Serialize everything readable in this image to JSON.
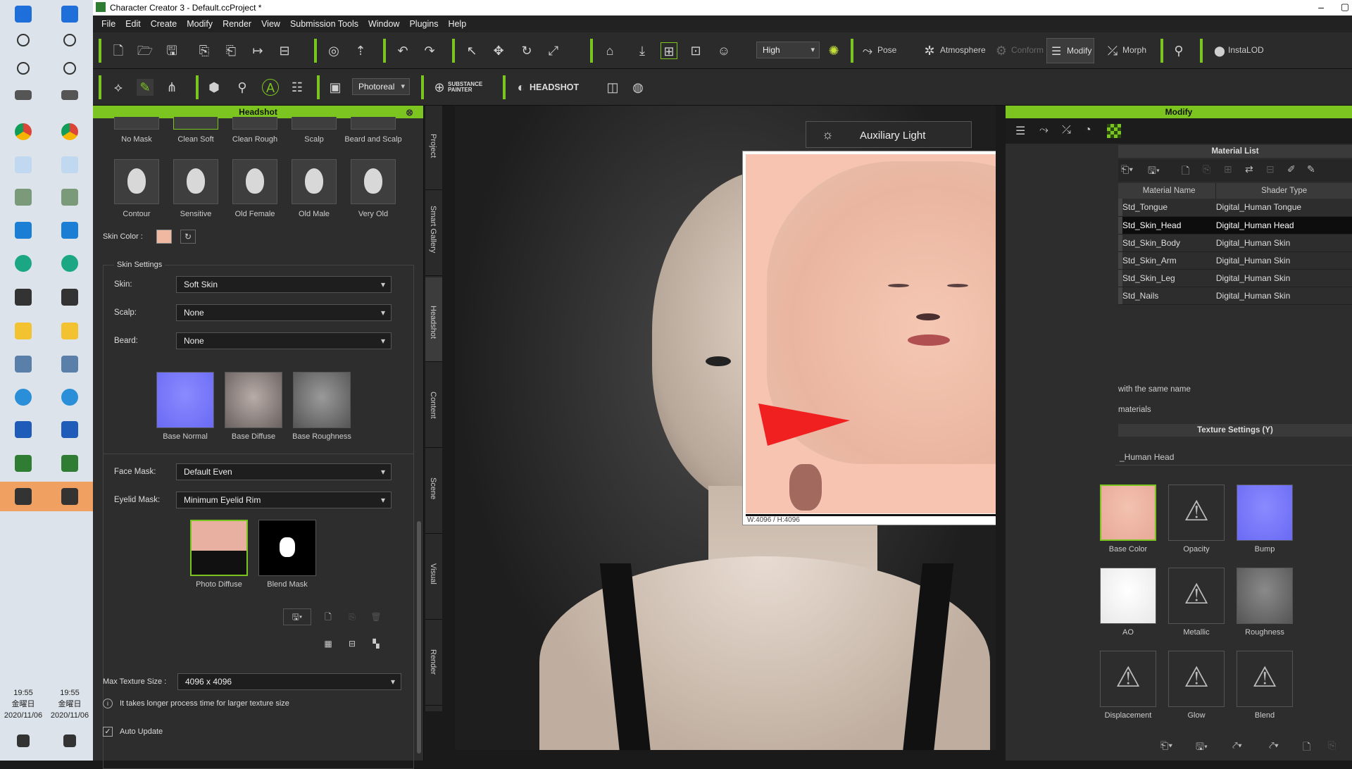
{
  "app": {
    "title": "Character Creator 3 - Default.ccProject *"
  },
  "menu": [
    "File",
    "Edit",
    "Create",
    "Modify",
    "Render",
    "View",
    "Submission Tools",
    "Window",
    "Plugins",
    "Help"
  ],
  "toolbar1": {
    "quality": "High",
    "pose_label": "Pose",
    "atmosphere_label": "Atmosphere",
    "conform_label": "Conform",
    "modify_label": "Modify",
    "morph_label": "Morph",
    "instalod_label": "InstaLOD"
  },
  "toolbar2": {
    "render_mode": "Photoreal",
    "substance_label": "SUBSTANCE PAINTER",
    "headshot_label": "HEADSHOT"
  },
  "headshot_panel": {
    "title": "Headshot",
    "top_presets": [
      {
        "label": "No Mask"
      },
      {
        "label": "Clean Soft"
      },
      {
        "label": "Clean Rough"
      },
      {
        "label": "Scalp"
      },
      {
        "label": "Beard and Scalp"
      }
    ],
    "presets": [
      {
        "label": "Contour"
      },
      {
        "label": "Sensitive"
      },
      {
        "label": "Old Female"
      },
      {
        "label": "Old Male"
      },
      {
        "label": "Very Old"
      }
    ],
    "skin_color_label": "Skin Color :",
    "skin_color": "#f0b8a0",
    "skin_settings_label": "Skin Settings",
    "skin_label": "Skin:",
    "skin_value": "Soft Skin",
    "scalp_label": "Scalp:",
    "scalp_value": "None",
    "beard_label": "Beard:",
    "beard_value": "None",
    "maps": [
      {
        "label": "Base Normal"
      },
      {
        "label": "Base Diffuse"
      },
      {
        "label": "Base Roughness"
      }
    ],
    "face_mask_label": "Face Mask:",
    "face_mask_value": "Default Even",
    "eyelid_mask_label": "Eyelid Mask:",
    "eyelid_mask_value": "Minimum Eyelid Rim",
    "photo_maps": [
      {
        "label": "Photo Diffuse"
      },
      {
        "label": "Blend Mask"
      }
    ],
    "max_texture_label": "Max Texture Size :",
    "max_texture_value": "4096 x 4096",
    "info_text": "It takes longer process time for larger texture size",
    "auto_update_label": "Auto Update"
  },
  "vertical_tabs": [
    "Project",
    "Smart Gallery",
    "Headshot",
    "Content",
    "Scene",
    "Visual",
    "Render"
  ],
  "viewport": {
    "aux_light_label": "Auxiliary Light",
    "texture_size": "W:4096 / H:4096"
  },
  "modify_panel": {
    "title": "Modify",
    "material_list_label": "Material List",
    "columns": [
      "Material Name",
      "Shader Type"
    ],
    "materials": [
      {
        "name": "Std_Tongue",
        "shader": "Digital_Human Tongue"
      },
      {
        "name": "Std_Skin_Head",
        "shader": "Digital_Human Head"
      },
      {
        "name": "Std_Skin_Body",
        "shader": "Digital_Human Skin"
      },
      {
        "name": "Std_Skin_Arm",
        "shader": "Digital_Human Skin"
      },
      {
        "name": "Std_Skin_Leg",
        "shader": "Digital_Human Skin"
      },
      {
        "name": "Std_Nails",
        "shader": "Digital_Human Skin"
      }
    ],
    "selected_index": 1,
    "same_name_text": "with the same name",
    "materials_text": "materials",
    "texture_settings_label": "Texture Settings  (Y)",
    "shader_name": "_Human Head",
    "textures": [
      {
        "label": "Base Color"
      },
      {
        "label": "Opacity"
      },
      {
        "label": "Bump"
      },
      {
        "label": "AO"
      },
      {
        "label": "Metallic"
      },
      {
        "label": "Roughness"
      },
      {
        "label": "Displacement"
      },
      {
        "label": "Glow"
      },
      {
        "label": "Blend"
      }
    ]
  },
  "taskbar": {
    "time": "19:55",
    "day": "金曜日",
    "date": "2020/11/06"
  }
}
